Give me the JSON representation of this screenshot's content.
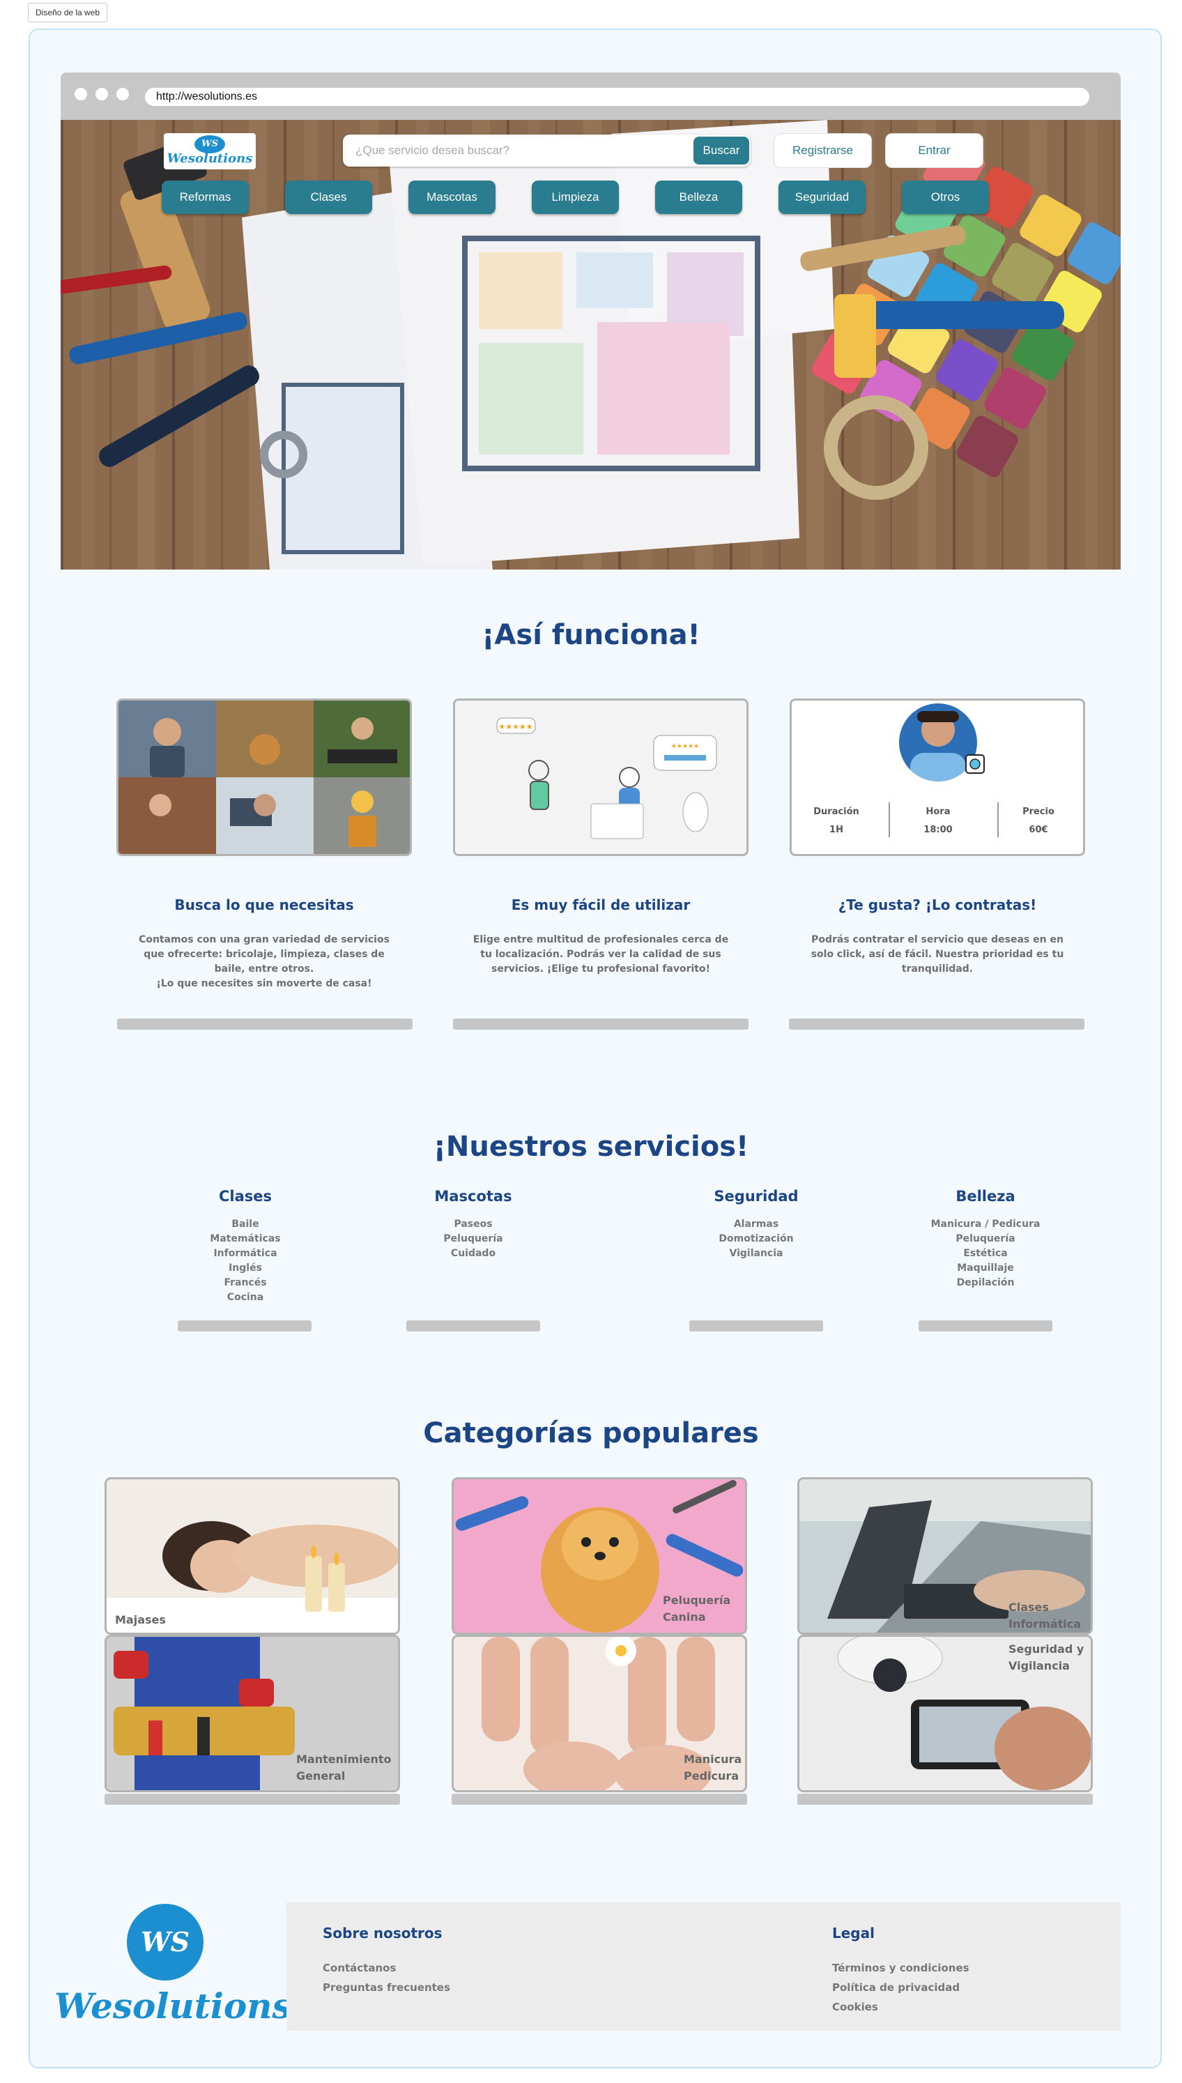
{
  "frame_label": "Diseño de la web",
  "browser": {
    "url": "http://wesolutions.es"
  },
  "brand": {
    "name": "Wesolutions",
    "monogram": "WS"
  },
  "header": {
    "search_placeholder": "¿Que servicio desea buscar?",
    "search_button": "Buscar",
    "register_button": "Registrarse",
    "login_button": "Entrar"
  },
  "nav": [
    "Reformas",
    "Clases",
    "Mascotas",
    "Limpieza",
    "Belleza",
    "Seguridad",
    "Otros"
  ],
  "how_it_works": {
    "title": "¡Así funciona!",
    "booking_card": {
      "labels": [
        "Duración",
        "Hora",
        "Precio"
      ],
      "values": [
        "1H",
        "18:00",
        "60€"
      ],
      "rating_stars": "★★★★★"
    },
    "steps": [
      {
        "title": "Busca lo que necesitas",
        "text": "Contamos con una gran variedad de servicios\nque ofrecerte: bricolaje, limpieza, clases de\nbaile, entre otros.\n¡Lo que necesites sin moverte de casa!"
      },
      {
        "title": "Es muy fácil de utilizar",
        "text": "Elige entre multitud de profesionales cerca de\ntu localización. Podrás ver la calidad de sus\nservicios. ¡Elige tu profesional favorito!"
      },
      {
        "title": "¿Te gusta? ¡Lo contratas!",
        "text": "Podrás contratar el servicio que deseas en en\nsolo click, así de fácil. Nuestra prioridad es tu\ntranquilidad."
      }
    ]
  },
  "services": {
    "title": "¡Nuestros servicios!",
    "columns": [
      {
        "name": "Clases",
        "items": [
          "Baile",
          "Matemáticas",
          "Informática",
          "Inglés",
          "Francés",
          "Cocina"
        ]
      },
      {
        "name": "Mascotas",
        "items": [
          "Paseos",
          "Peluquería",
          "Cuidado"
        ]
      },
      {
        "name": "Seguridad",
        "items": [
          "Alarmas",
          "Domotización",
          "Vigilancia"
        ]
      },
      {
        "name": "Belleza",
        "items": [
          "Manicura / Pedicura",
          "Peluquería",
          "Estética",
          "Maquillaje",
          "Depilación"
        ]
      }
    ]
  },
  "popular": {
    "title": "Categorías populares",
    "tiles": [
      {
        "label": "Majases"
      },
      {
        "label": "Peluquería\nCanina"
      },
      {
        "label": "Clases\nInformática"
      },
      {
        "label": "Mantenimiento\nGeneral"
      },
      {
        "label": "Manicura\nPedicura"
      },
      {
        "label": "Seguridad y\nVigilancia"
      }
    ]
  },
  "footer": {
    "about": {
      "title": "Sobre nosotros",
      "links": [
        "Contáctanos",
        "Preguntas frecuentes"
      ]
    },
    "legal": {
      "title": "Legal",
      "links": [
        "Términos y condiciones",
        "Política de privacidad",
        "Cookies"
      ]
    }
  },
  "colors": {
    "brand_blue": "#1c8fd0",
    "teal": "#2a7d8f",
    "heading_navy": "#1c4585",
    "page_bg": "#f4f9fd"
  }
}
